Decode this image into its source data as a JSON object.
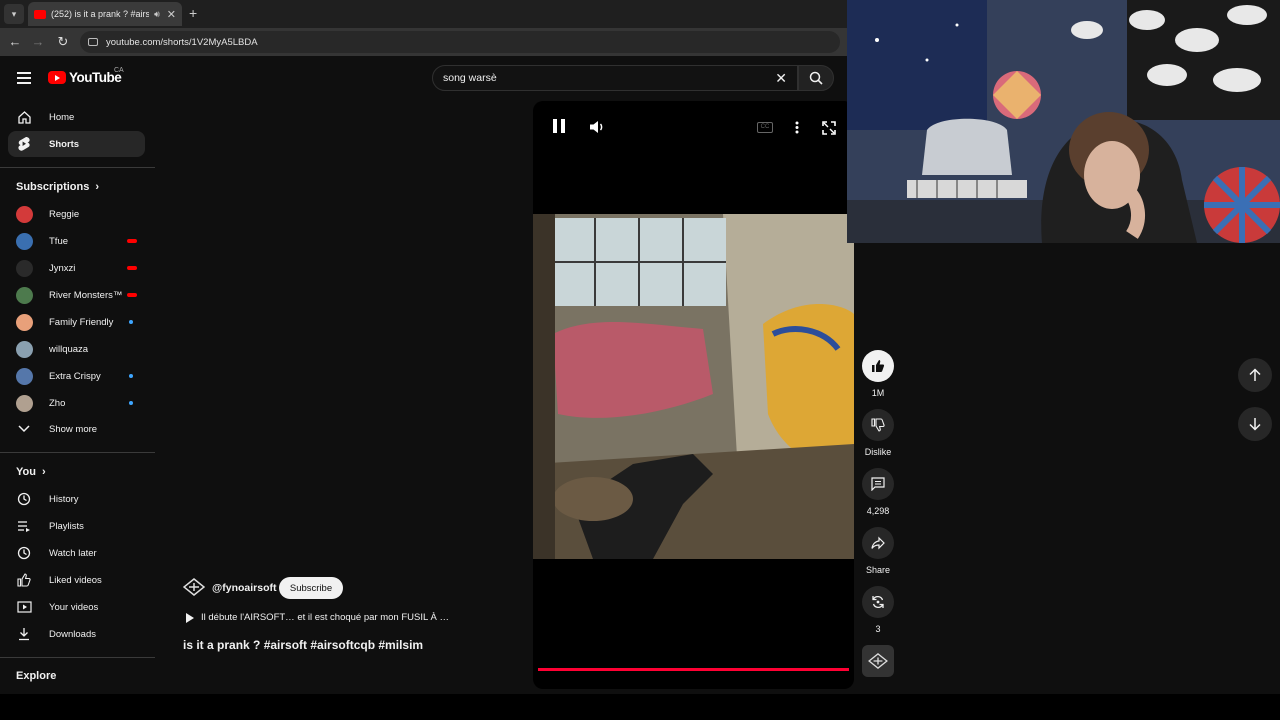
{
  "browser": {
    "tab_title": "(252) is it a prank ? #airsoft",
    "url": "youtube.com/shorts/1V2MyA5LBDA"
  },
  "header": {
    "logo_text": "YouTube",
    "country_code": "CA",
    "search_value": "song warsè"
  },
  "sidebar": {
    "home": "Home",
    "shorts": "Shorts",
    "subscriptions_title": "Subscriptions",
    "subscriptions": [
      {
        "name": "Reggie",
        "color": "#d33a3a",
        "indicator": "none"
      },
      {
        "name": "Tfue",
        "color": "#3a6fb0",
        "indicator": "live"
      },
      {
        "name": "Jynxzi",
        "color": "#2a2a2a",
        "indicator": "live"
      },
      {
        "name": "River Monsters™",
        "color": "#4d7a4d",
        "indicator": "live"
      },
      {
        "name": "Family Friendly",
        "color": "#e8a07a",
        "indicator": "new"
      },
      {
        "name": "willquaza",
        "color": "#8aa0b0",
        "indicator": "none"
      },
      {
        "name": "Extra Crispy",
        "color": "#5577aa",
        "indicator": "new"
      },
      {
        "name": "Zho",
        "color": "#b0a090",
        "indicator": "new"
      }
    ],
    "show_more": "Show more",
    "you_title": "You",
    "you_items": [
      "History",
      "Playlists",
      "Watch later",
      "Liked videos",
      "Your videos",
      "Downloads"
    ],
    "explore_title": "Explore"
  },
  "video": {
    "channel": "@fynoairsoft",
    "subscribe": "Subscribe",
    "related": "Il débute l'AIRSOFT… et il est choqué par mon FUSIL À …",
    "title": "is it a prank ? #airsoft #airsoftcqb #milsim",
    "progress_fraction": 1.0
  },
  "actions": {
    "likes": "1M",
    "dislike": "Dislike",
    "comments": "4,298",
    "share": "Share",
    "remix": "3"
  },
  "colors": {
    "background": "#0f0f0f",
    "accent_red": "#ff0000",
    "progress": "#ff0033",
    "live": "#ff0000",
    "new": "#3ea6ff"
  }
}
